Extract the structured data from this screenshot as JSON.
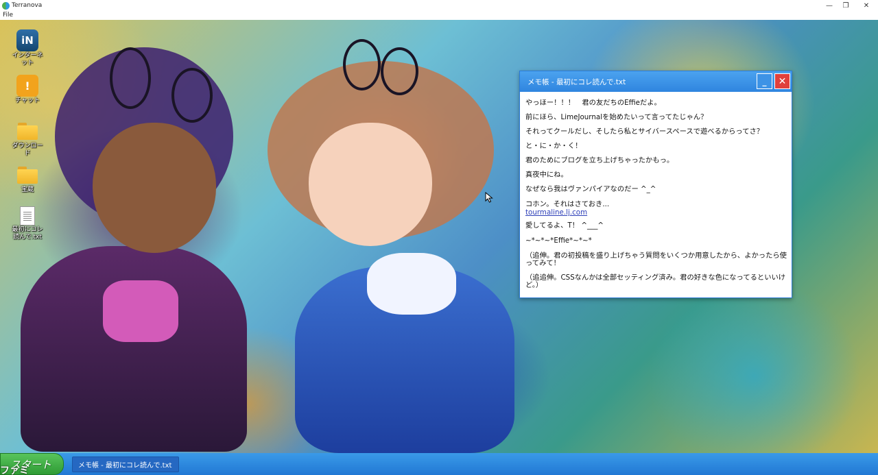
{
  "host": {
    "app_title": "Terranova",
    "menu": {
      "file": "File"
    },
    "controls": {
      "minimize": "—",
      "maximize": "❐",
      "close": "✕"
    }
  },
  "desktop": {
    "icons": [
      {
        "label": "インターネット",
        "icon": "internet-icon",
        "glyph": "iN"
      },
      {
        "label": "チャット",
        "icon": "chat-icon",
        "glyph": "!"
      },
      {
        "label": "ダウンロード",
        "icon": "folder-icon"
      },
      {
        "label": "宝蔵",
        "icon": "folder-icon"
      },
      {
        "label": "最初にコレ読んで.txt",
        "icon": "text-file-icon"
      }
    ]
  },
  "notepad": {
    "title": "メモ帳 - 最初にコレ読んで.txt",
    "minimize": "_",
    "close": "✕",
    "lines": [
      "やっほー！！！　君の友だちのEffieだよ。",
      "前にほら、LimeJournalを始めたいって言ってたじゃん？",
      "それってクールだし、そしたら私とサイバースペースで遊べるからってさ？",
      "と・に・か・く！",
      "君のためにブログを立ち上げちゃったかもっ。",
      "真夜中にね。",
      "なぜなら我はヴァンパイアなのだー ^_^",
      "コホン。それはさておき...",
      "愛してるよ、T！ ^___^",
      "~*~*~*Effie*~*~*",
      "（追伸。君の初投稿を盛り上げちゃう質問をいくつか用意したから、よかったら使ってみて！",
      "（追追伸。CSSなんかは全部セッティング済み。君の好きな色になってるといいけど。）"
    ],
    "link": "tourmaline.lj.com"
  },
  "taskbar": {
    "start": "スタート",
    "tasks": [
      {
        "label": "メモ帳 - 最初にコレ読んで.txt"
      }
    ]
  },
  "watermark": "ファミ通.com",
  "colors": {
    "taskbar": "#2178d4",
    "start": "#2f9b35",
    "window_title": "#2f85df",
    "close": "#e0403c",
    "link": "#2d3fb8"
  }
}
